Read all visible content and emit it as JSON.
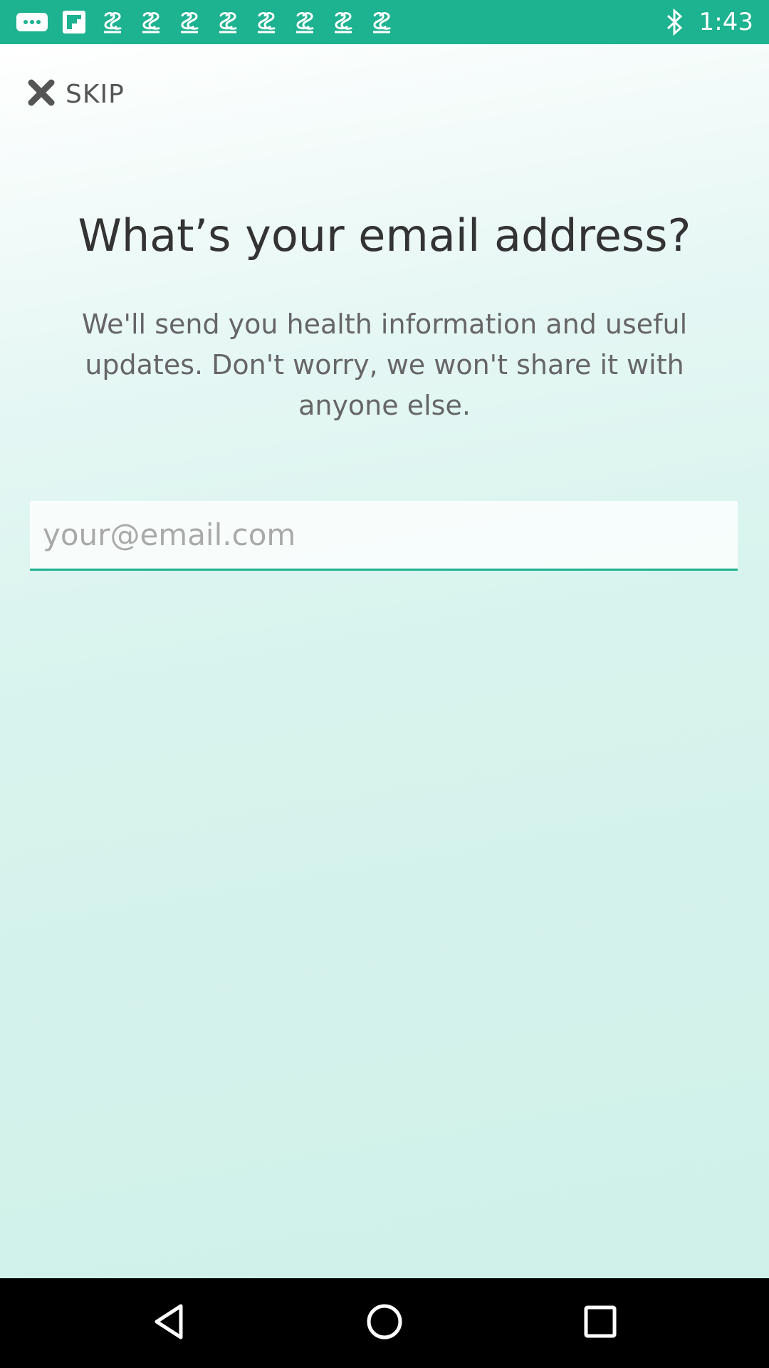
{
  "status_bar": {
    "time": "1:43",
    "color": "#1db290",
    "left_icons": [
      "messenger-icon",
      "flipboard-icon",
      "app-notification-icon",
      "app-notification-icon",
      "app-notification-icon",
      "app-notification-icon",
      "app-notification-icon",
      "app-notification-icon",
      "app-notification-icon",
      "app-notification-icon",
      "app-notification-icon"
    ],
    "right_icons": [
      "bluetooth-icon"
    ]
  },
  "header": {
    "skip_label": "SKIP",
    "skip_icon": "close-icon"
  },
  "main": {
    "title": "What’s your email address?",
    "subtitle": "We'll send you health information and useful updates. Don't worry, we won't share it with anyone else.",
    "email": {
      "placeholder": "your@email.com",
      "value": ""
    }
  },
  "nav_bar": {
    "buttons": [
      "back-icon",
      "home-icon",
      "recents-icon"
    ]
  },
  "colors": {
    "accent": "#1db290",
    "title_text": "#333333",
    "body_text": "#666666"
  }
}
